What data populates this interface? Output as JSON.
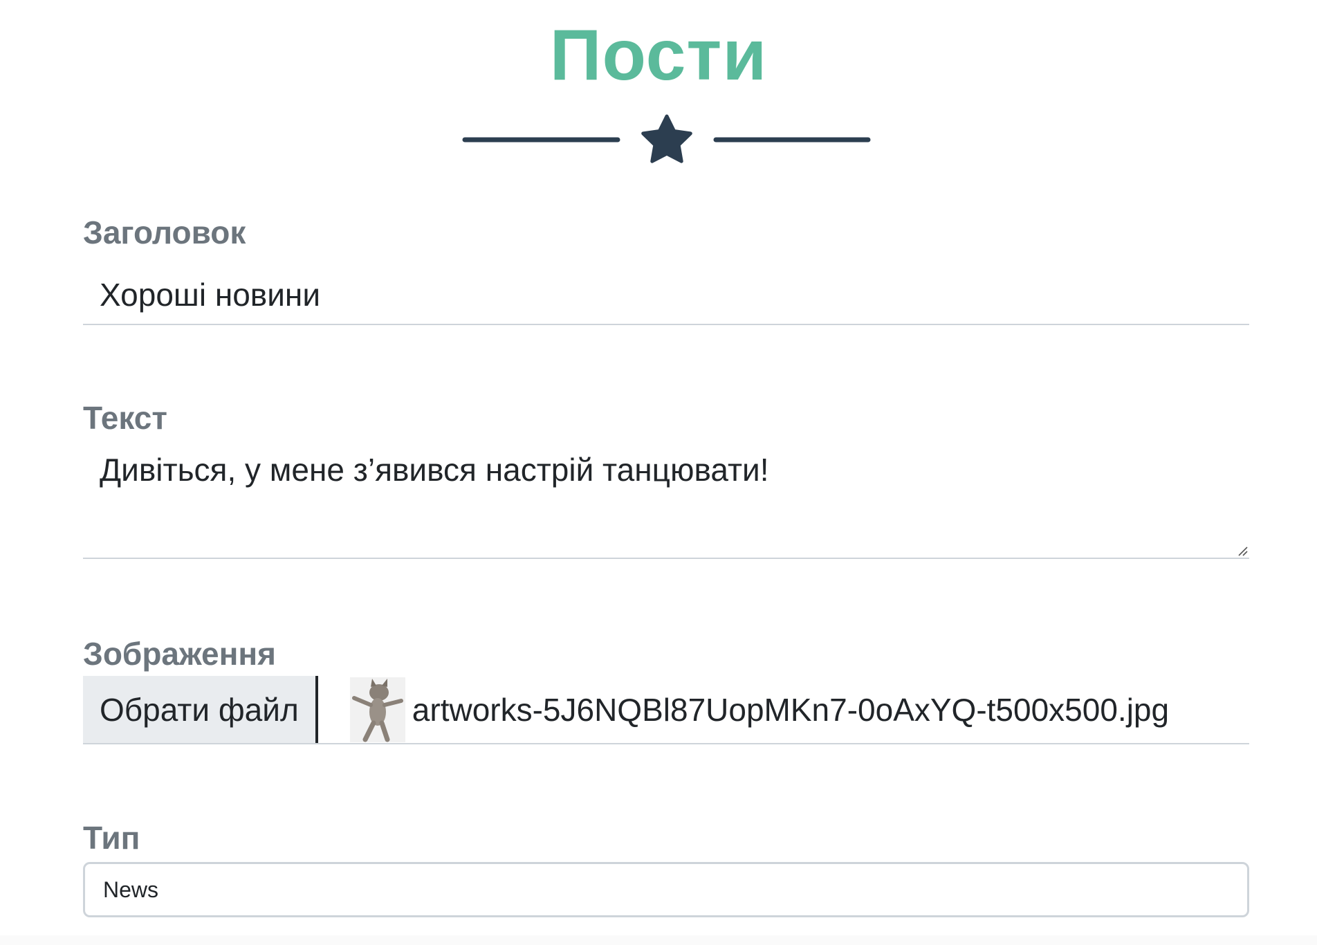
{
  "page": {
    "title": "Пости"
  },
  "colors": {
    "title": "#5bba9b",
    "divider": "#2c3e50",
    "label": "#6c757d",
    "border": "#ced4da",
    "file_button_bg": "#e9ecef"
  },
  "form": {
    "title_field": {
      "label": "Заголовок",
      "value": "Хороші новини"
    },
    "text_field": {
      "label": "Текст",
      "value": "Дивіться, у мене з’явився настрій танцювати!"
    },
    "image_field": {
      "label": "Зображення",
      "button_label": "Обрати файл",
      "file_name": "artworks-5J6NQBl87UopMKn7-0oAxYQ-t500x500.jpg",
      "thumbnail_icon": "dancing-cat-thumbnail"
    },
    "type_field": {
      "label": "Тип",
      "selected": "News"
    }
  },
  "icons": {
    "divider": "star-icon"
  }
}
